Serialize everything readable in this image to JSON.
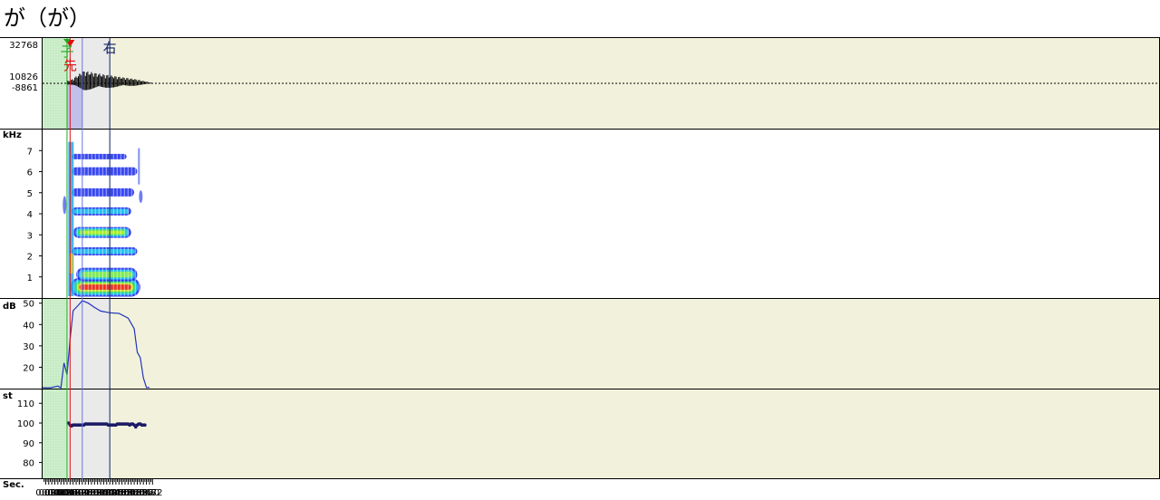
{
  "title": "が（が）",
  "colors": {
    "panel_bg": "#eaeaea",
    "green_region": "#c8ecc6",
    "beige_region": "#f2f2dc",
    "selection": "#b9b9ea",
    "waveform": "#000000",
    "intensity_line": "#2233bb",
    "pitch_dots": "#1a1a66",
    "cursor_green": "#22aa22",
    "cursor_red": "#dd1111",
    "cursor_blue": "#6677dd",
    "cursor_navy": "#112266"
  },
  "waveform": {
    "y_max_label": "32768",
    "y_labels": [
      "10826",
      "-8861"
    ]
  },
  "markers": {
    "green": {
      "label": "子",
      "time": 0.16
    },
    "red": {
      "label": "先",
      "time": 0.18
    },
    "blue": {
      "time": 0.26
    },
    "navy": {
      "label": "右",
      "time": 0.44
    }
  },
  "regions": {
    "green": [
      0.0,
      0.16
    ],
    "beige": [
      0.44,
      0.73
    ],
    "selection": [
      0.16,
      0.26
    ]
  },
  "chart_data": {
    "type": "line",
    "x_axis": {
      "label": "Sec.",
      "range": [
        0.0,
        0.73
      ],
      "ticks": [
        "0.02",
        "0.04",
        "0.06",
        "0.08",
        "0.10",
        "0.12",
        "0.14",
        "0.16",
        "0.18",
        "0.20",
        "0.22",
        "0.24",
        "0.26",
        "0.28",
        "0.30",
        "0.32",
        "0.34",
        "0.36",
        "0.38",
        "0.40",
        "0.42",
        "0.44",
        "0.46",
        "0.48",
        "0.50",
        "0.52",
        "0.54",
        "0.56",
        "0.58",
        "0.60",
        "0.62",
        "0.64",
        "0.66",
        "0.68",
        "0.70",
        "0.72"
      ]
    },
    "spectrogram": {
      "ylabel": "kHz",
      "ylim": [
        0,
        8
      ],
      "ticks": [
        "1",
        "2",
        "3",
        "4",
        "5",
        "6",
        "7"
      ],
      "voicing": [
        0.18,
        0.64
      ]
    },
    "intensity": {
      "ylabel": "dB",
      "ylim": [
        10,
        52
      ],
      "ticks": [
        "20",
        "30",
        "40",
        "50"
      ],
      "x": [
        0.0,
        0.01,
        0.05,
        0.1,
        0.12,
        0.14,
        0.16,
        0.18,
        0.2,
        0.24,
        0.26,
        0.3,
        0.34,
        0.38,
        0.44,
        0.5,
        0.56,
        0.6,
        0.62,
        0.64,
        0.66,
        0.68,
        0.7
      ],
      "values": [
        10.5,
        10.4,
        10.4,
        11.2,
        10.4,
        22.0,
        16.5,
        33.0,
        46.5,
        49.5,
        51.2,
        50.0,
        48.0,
        46.3,
        45.5,
        45.2,
        43.0,
        38.0,
        27.0,
        24.5,
        15.0,
        10.5,
        10.6
      ]
    },
    "pitch": {
      "ylabel": "st",
      "ylim": [
        72,
        117
      ],
      "ticks": [
        "80",
        "90",
        "100",
        "110"
      ],
      "x": [
        0.17,
        0.18,
        0.19,
        0.2,
        0.21,
        0.22,
        0.23,
        0.24,
        0.25,
        0.26,
        0.27,
        0.28,
        0.29,
        0.3,
        0.31,
        0.32,
        0.33,
        0.34,
        0.35,
        0.36,
        0.37,
        0.38,
        0.39,
        0.4,
        0.41,
        0.42,
        0.43,
        0.44,
        0.45,
        0.46,
        0.47,
        0.48,
        0.49,
        0.5,
        0.51,
        0.52,
        0.53,
        0.54,
        0.55,
        0.56,
        0.57,
        0.58,
        0.59,
        0.6,
        0.61,
        0.62,
        0.63,
        0.64,
        0.65,
        0.66,
        0.67
      ],
      "values": [
        100,
        99,
        98.5,
        99,
        99,
        99,
        99,
        99,
        99,
        99,
        99,
        99.5,
        99.5,
        99.5,
        99.5,
        99.5,
        99.5,
        99.5,
        99.5,
        99.5,
        99.5,
        99.5,
        99.5,
        99.5,
        99.5,
        99.5,
        99,
        99,
        99,
        99,
        99,
        99,
        99.5,
        99.5,
        99.5,
        99.5,
        99.5,
        99.5,
        99.5,
        99.5,
        99,
        99.5,
        99.5,
        99,
        98,
        99,
        99.5,
        99.5,
        99,
        99,
        99
      ]
    }
  }
}
